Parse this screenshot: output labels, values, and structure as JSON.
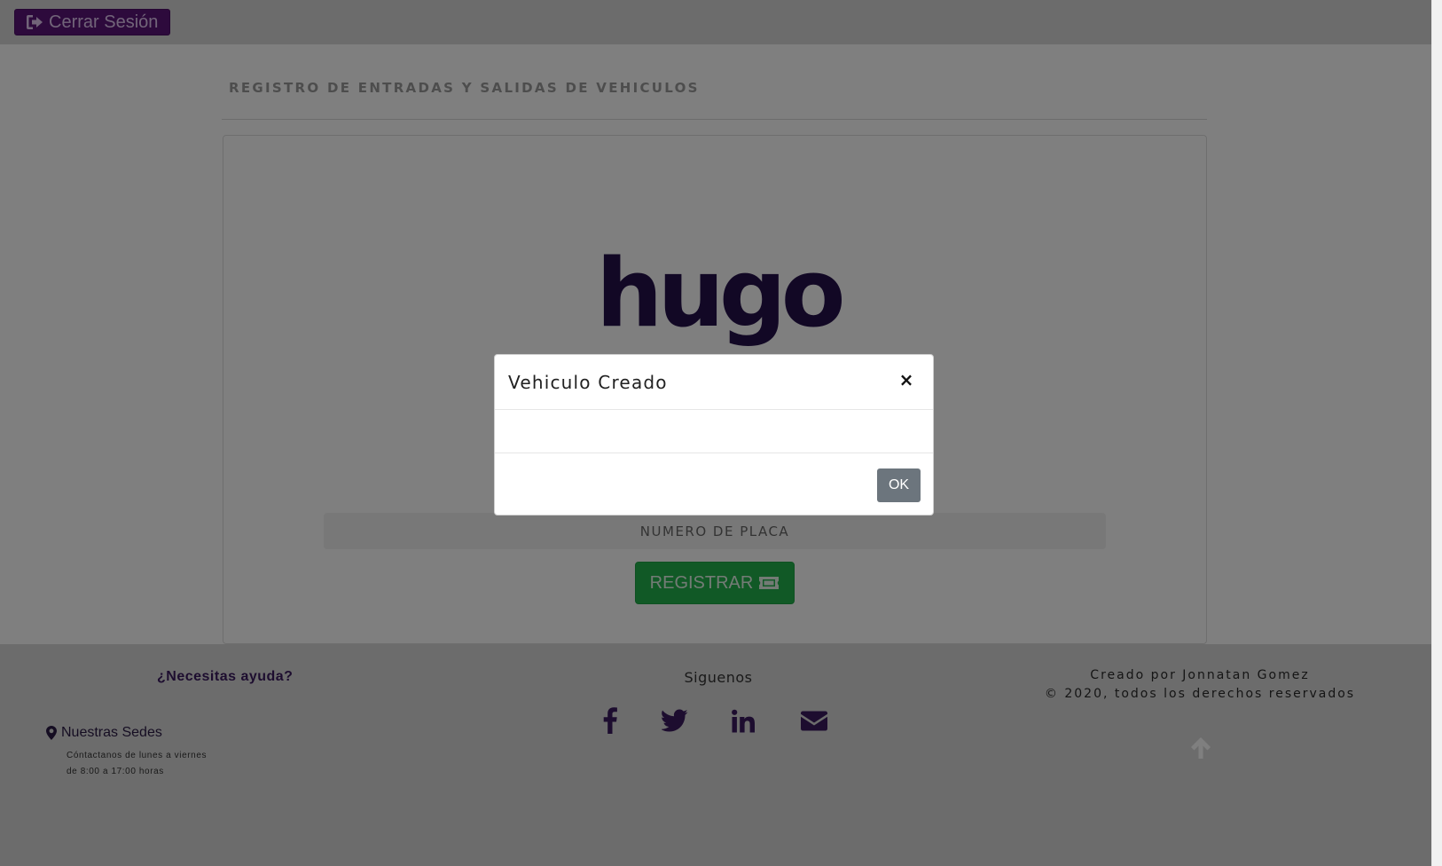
{
  "topbar": {
    "logout_label": "Cerrar Sesión"
  },
  "main": {
    "title": "REGISTRO DE ENTRADAS Y SALIDAS DE VEHICULOS",
    "logo_text": "hugo",
    "plate_placeholder": "NUMERO DE PLACA",
    "register_label": "REGISTRAR"
  },
  "footer": {
    "help_title": "¿Necesitas ayuda?",
    "sedes_title": "Nuestras Sedes",
    "sedes_line1": "Cóntactanos de lunes a viernes",
    "sedes_line2": "de 8:00 a 17:00 horas",
    "follow_title": "Siguenos",
    "credits_line1": "Creado por Jonnatan Gomez",
    "credits_line2": "© 2020, todos los derechos reservados"
  },
  "modal": {
    "title": "Vehiculo Creado",
    "close_symbol": "×",
    "body_text": "",
    "ok_label": "OK"
  },
  "colors": {
    "brand_purple": "#5a1478",
    "logo_navy": "#24104a",
    "register_green": "#22b24c",
    "ok_gray": "#6c757d"
  },
  "icons": [
    "sign-out-icon",
    "ticket-icon",
    "map-marker-icon",
    "facebook-icon",
    "twitter-icon",
    "linkedin-icon",
    "envelope-icon",
    "arrow-up-icon"
  ]
}
